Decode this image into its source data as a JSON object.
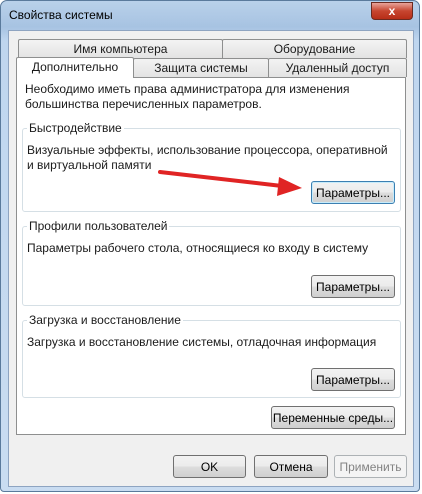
{
  "window": {
    "title": "Свойства системы",
    "close_glyph": "x"
  },
  "tabs_row1": [
    {
      "label": "Имя компьютера"
    },
    {
      "label": "Оборудование"
    }
  ],
  "tabs_row2": [
    {
      "label": "Дополнительно",
      "active": true
    },
    {
      "label": "Защита системы"
    },
    {
      "label": "Удаленный доступ"
    }
  ],
  "panel": {
    "note": "Необходимо иметь права администратора для изменения большинства перечисленных параметров.",
    "performance": {
      "title": "Быстродействие",
      "description": "Визуальные эффекты, использование процессора, оперативной и виртуальной памяти",
      "button": "Параметры..."
    },
    "profiles": {
      "title": "Профили пользователей",
      "description": "Параметры рабочего стола, относящиеся ко входу в систему",
      "button": "Параметры..."
    },
    "startup": {
      "title": "Загрузка и восстановление",
      "description": "Загрузка и восстановление системы, отладочная информация",
      "button": "Параметры..."
    },
    "env_button": "Переменные среды..."
  },
  "footer": {
    "ok": "OK",
    "cancel": "Отмена",
    "apply": "Применить"
  },
  "annotation": {
    "arrow_color": "#e02424"
  }
}
